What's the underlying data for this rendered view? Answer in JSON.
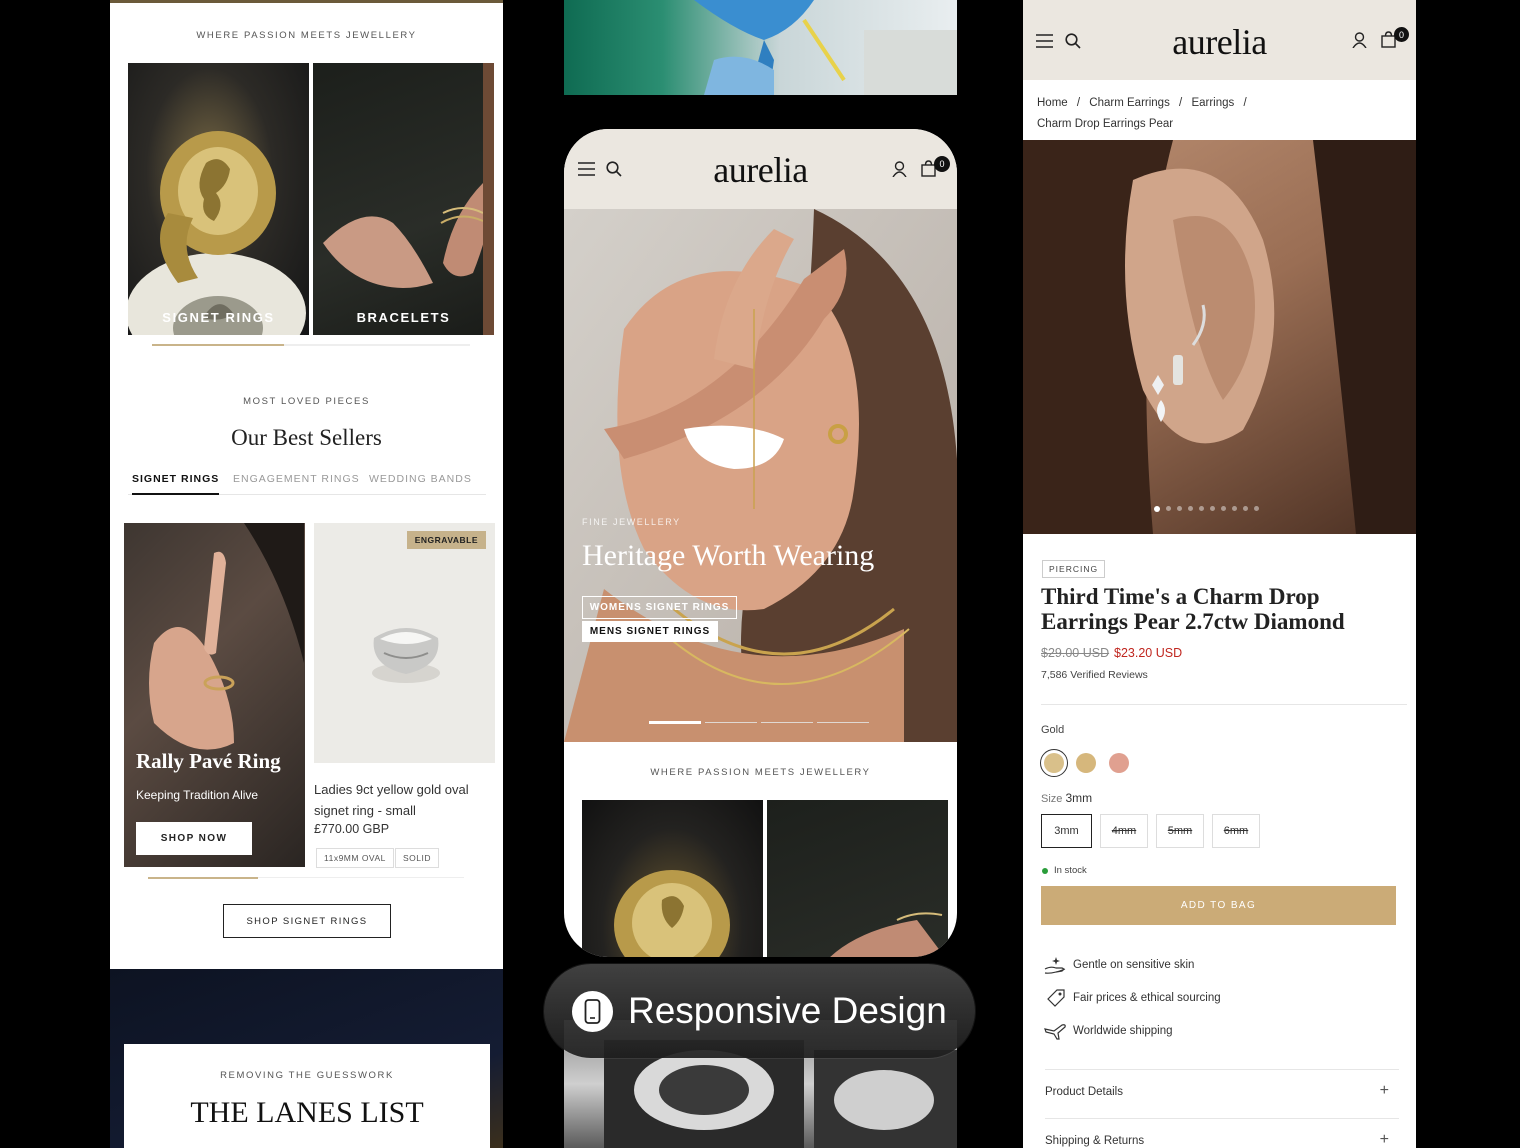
{
  "left": {
    "eyebrow": "WHERE PASSION MEETS JEWELLERY",
    "tiles": [
      {
        "label": "SIGNET RINGS"
      },
      {
        "label": "BRACELETS"
      }
    ],
    "bestsellers": {
      "eyebrow": "MOST LOVED PIECES",
      "title": "Our Best Sellers",
      "tabs": [
        "SIGNET RINGS",
        "ENGAGEMENT RINGS",
        "WEDDING BANDS"
      ],
      "promo": {
        "title": "Rally Pavé Ring",
        "subtitle": "Keeping Tradition Alive",
        "button": "SHOP NOW"
      },
      "product": {
        "badge": "ENGRAVABLE",
        "name_line1": "Ladies 9ct yellow gold oval",
        "name_line2": "signet ring - small",
        "price": "£770.00 GBP",
        "tags": [
          "11x9MM OVAL",
          "SOLID"
        ]
      },
      "cta": "SHOP SIGNET RINGS"
    },
    "lanes": {
      "eyebrow": "REMOVING THE GUESSWORK",
      "title": "THE LANES LIST"
    }
  },
  "phone": {
    "brand": "aurelia",
    "cart_count": "0",
    "hero": {
      "eyebrow": "FINE JEWELLERY",
      "title": "Heritage Worth Wearing",
      "buttons": [
        "WOMENS SIGNET RINGS",
        "MENS SIGNET RINGS"
      ]
    },
    "eyebrow": "WHERE PASSION MEETS JEWELLERY"
  },
  "badge": {
    "label": "Responsive Design"
  },
  "right": {
    "brand": "aurelia",
    "cart_count": "0",
    "breadcrumb": {
      "home": "Home",
      "c1": "Charm Earrings",
      "c2": "Earrings",
      "current": "Charm Drop Earrings Pear"
    },
    "product": {
      "category": "PIERCING",
      "title_line1": "Third Time's a Charm Drop",
      "title_line2": "Earrings Pear 2.7ctw Diamond",
      "old_price": "$29.00 USD",
      "price": "$23.20 USD",
      "reviews": "7,586 Verified Reviews",
      "colour_label": "Gold",
      "colours": [
        "#d9c08a",
        "#d6b77c",
        "#e0a090"
      ],
      "size_label": "Size",
      "size_value": "3mm",
      "sizes": [
        "3mm",
        "4mm",
        "5mm",
        "6mm"
      ],
      "stock": "In stock",
      "add_to_bag": "ADD TO BAG",
      "features": [
        "Gentle on sensitive skin",
        "Fair prices & ethical sourcing",
        "Worldwide shipping"
      ],
      "accordions": [
        "Product Details",
        "Shipping & Returns"
      ]
    }
  },
  "colors": {
    "gold_button": "#cbab77",
    "sale_red": "#c0261f",
    "in_stock": "#2a9d3a",
    "header_bg": "#ebe7e0"
  }
}
